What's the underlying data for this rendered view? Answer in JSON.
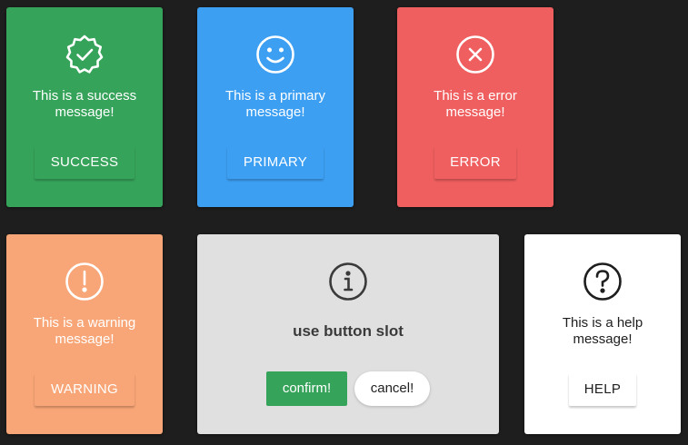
{
  "colors": {
    "background": "#1e1e1e",
    "success": "#36a35a",
    "primary": "#3d9ff2",
    "error": "#ef5f5f",
    "warning": "#f8a677",
    "info": "#e0e0e0",
    "help": "#ffffff"
  },
  "cards": {
    "success": {
      "icon": "badge-check-icon",
      "message": "This is a success\nmessage!",
      "button": "SUCCESS"
    },
    "primary": {
      "icon": "smile-icon",
      "message": "This is a primary\nmessage!",
      "button": "PRIMARY"
    },
    "error": {
      "icon": "close-circle-icon",
      "message": "This is a error\nmessage!",
      "button": "ERROR"
    },
    "warning": {
      "icon": "exclamation-circle-icon",
      "message": "This is a warning\nmessage!",
      "button": "WARNING"
    },
    "info": {
      "icon": "info-circle-icon",
      "title": "use button slot",
      "confirm": "confirm!",
      "cancel": "cancel!"
    },
    "help": {
      "icon": "question-circle-icon",
      "message": "This is a help\nmessage!",
      "button": "HELP"
    }
  }
}
